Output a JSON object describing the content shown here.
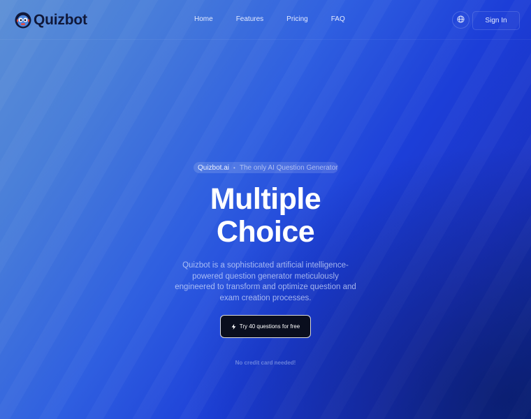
{
  "brand": {
    "name": "Quizbot",
    "logo_icon": "robot-face-icon",
    "name_color": "#10183a"
  },
  "nav": {
    "items": [
      {
        "label": "Home"
      },
      {
        "label": "Features"
      },
      {
        "label": "Pricing"
      },
      {
        "label": "FAQ"
      }
    ]
  },
  "header_actions": {
    "language_icon": "globe-icon",
    "signin_label": "Sign In"
  },
  "hero": {
    "badge_brand": "Quizbot.ai",
    "badge_separator": "•",
    "badge_text": "The only AI Question Generator",
    "title_line1": "Multiple",
    "title_line2": "Choice",
    "description": "Quizbot is a sophisticated artificial intelligence-powered question generator meticulously engineered to transform and optimize question and exam creation processes.",
    "cta_label": "Try 40 questions for free",
    "cta_icon": "lightning-bolt-icon",
    "note": "No credit card needed!"
  },
  "colors": {
    "background_start": "#5c8fd6",
    "background_end": "#0e2a94",
    "cta_background": "#0a0e1e"
  }
}
